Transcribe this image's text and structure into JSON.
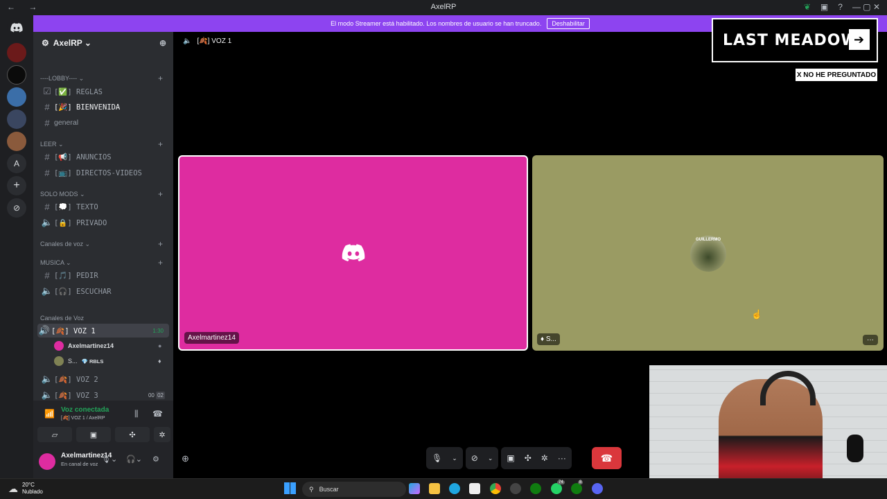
{
  "window": {
    "title": "AxelRP",
    "nav": "← →",
    "controls": "— ▢ ✕"
  },
  "streamer": {
    "message": "El modo Streamer está habilitado. Los nombres de usuario se han truncado.",
    "button": "Deshabilitar"
  },
  "guilds": {
    "dm_icon": "discord-logo",
    "letter": "A",
    "add": "+",
    "explore": "⊘"
  },
  "server": {
    "name": "AxelRP ⌄"
  },
  "categories": {
    "lobby": "----LOBBY---- ⌄",
    "leer": "LEER ⌄",
    "solo_mods": "SOLO MODS ⌄",
    "canales_de_voz": "Canales de voz ⌄",
    "musica": "MUSICA ⌄",
    "canales_voz2": "Canales de Voz"
  },
  "channels": {
    "reglas": "[✅] REGLAS",
    "bienvenida": "[🎉] BIENVENIDA",
    "general": "general",
    "anuncios": "[📢] ANUNCIOS",
    "directos": "[📺] DIRECTOS-VIDEOS",
    "texto": "[💭] TEXTO",
    "privado": "[🔒] PRIVADO",
    "pedir": "[🎵] PEDIR",
    "escuchar": "[🎧] ESCUCHAR",
    "voz1": "[🍂] VOZ 1",
    "voz1_timer": "1:30",
    "voz2": "[🍂] VOZ 2",
    "voz3": "[🍂] VOZ 3",
    "voz3_tag1": "00",
    "voz3_tag2": "02"
  },
  "voice_members": [
    {
      "name": "Axelmartinez14",
      "extra": ""
    },
    {
      "name": "S...",
      "extra": "💎 RBLS"
    }
  ],
  "voice_status": {
    "connected": "Voz conectada",
    "location": "[🍂] VOZ 1 / AxelRP"
  },
  "user": {
    "name": "Axelmartinez14",
    "status": "En canal de voz"
  },
  "call": {
    "channel": "[🍂] VOZ 1"
  },
  "tiles": [
    {
      "label": "Axelmartinez14",
      "color": "#de2ca0"
    },
    {
      "label": "S...",
      "color": "#9a9b63",
      "avatar_caption": "GUILLERMO"
    }
  ],
  "overlay": {
    "logo": "LAST MEADOW",
    "badge": "X NO HE PREGUNTADO"
  },
  "taskbar": {
    "temp": "20°C",
    "weather": "Nublado",
    "search": "Buscar",
    "badge1": "74",
    "badge2": "8"
  },
  "colors": {
    "accent": "#8d44f0",
    "danger": "#da373c",
    "online": "#23a55a"
  }
}
